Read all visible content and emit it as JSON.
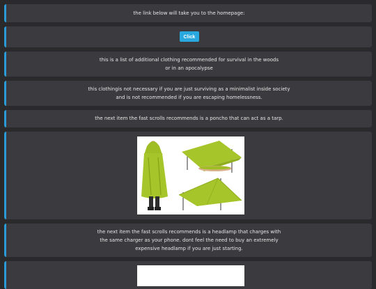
{
  "homepage_card": {
    "text": "the link below will take you to the homepage:"
  },
  "button_card": {
    "label": "Click"
  },
  "card_list": {
    "line1": "this is a list of additional clothing recommended for survival in the woods",
    "line2": "or in an apocalypse"
  },
  "card_note": {
    "line1": "this clothingis not necessary if you are just surviving as a minimalist inside society",
    "line2": "and is not recommended if you are escaping homelessness."
  },
  "card_poncho": {
    "text": "the next item the fast scrolls recommends is a poncho that can act as a tarp."
  },
  "card_headlamp": {
    "line1": "the next item the fast scrolls recommends is a headlamp that charges with",
    "line2": "the same charger as your phone. dont feel the need to buy an extremely",
    "line3": "expensive headlamp if you are just starting."
  },
  "colors": {
    "background": "#2a2a2d",
    "card": "#3b3b3f",
    "accent": "#2a9bd6",
    "button": "#29a8e0",
    "poncho": "#a6c52a"
  }
}
